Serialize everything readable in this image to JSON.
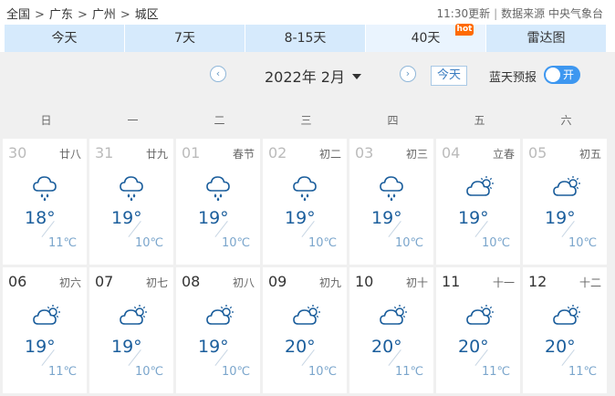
{
  "breadcrumb": [
    {
      "label": "全国",
      "slug": "nation"
    },
    {
      "label": "广东",
      "slug": "guangdong"
    },
    {
      "label": "广州",
      "slug": "guangzhou"
    },
    {
      "label": "城区",
      "slug": "district"
    }
  ],
  "breadcrumb_sep": ">",
  "meta": {
    "update": "11:30更新",
    "source": "数据来源 中央气象台"
  },
  "tabs": [
    {
      "label": "今天",
      "slug": "today",
      "active": false
    },
    {
      "label": "7天",
      "slug": "7day",
      "active": false
    },
    {
      "label": "8-15天",
      "slug": "8-15day",
      "active": false
    },
    {
      "label": "40天",
      "slug": "40day",
      "active": true,
      "badge": "hot"
    },
    {
      "label": "雷达图",
      "slug": "radar",
      "active": false
    }
  ],
  "month_nav": {
    "prev_glyph": "‹",
    "next_glyph": "›",
    "month": "2022年 2月",
    "today_label": "今天"
  },
  "bluesky": {
    "label": "蓝天预报",
    "toggle_label": "开",
    "on": true
  },
  "weekdays": [
    "日",
    "一",
    "二",
    "三",
    "四",
    "五",
    "六"
  ],
  "colors": {
    "tab_bg": "#d6eafc",
    "hi_temp": "#1b5e9c",
    "lo_temp": "#7ba6cc",
    "toggle": "#3d97f0",
    "hot_badge": "#ff6a00"
  },
  "days": [
    {
      "day": "30",
      "lunar": "廿八",
      "icon": "rain-icon",
      "hi": "18°",
      "lo": "11℃",
      "other_month": true
    },
    {
      "day": "31",
      "lunar": "廿九",
      "icon": "rain-icon",
      "hi": "19°",
      "lo": "10℃",
      "other_month": true
    },
    {
      "day": "01",
      "lunar": "春节",
      "icon": "rain-icon",
      "hi": "19°",
      "lo": "10℃",
      "other_month": true
    },
    {
      "day": "02",
      "lunar": "初二",
      "icon": "rain-icon",
      "hi": "19°",
      "lo": "10℃",
      "other_month": true
    },
    {
      "day": "03",
      "lunar": "初三",
      "icon": "rain-icon",
      "hi": "19°",
      "lo": "10℃",
      "other_month": true
    },
    {
      "day": "04",
      "lunar": "立春",
      "icon": "partly-cloudy-icon",
      "hi": "19°",
      "lo": "10℃",
      "other_month": true
    },
    {
      "day": "05",
      "lunar": "初五",
      "icon": "partly-cloudy-icon",
      "hi": "19°",
      "lo": "10℃",
      "other_month": true
    },
    {
      "day": "06",
      "lunar": "初六",
      "icon": "partly-cloudy-icon",
      "hi": "19°",
      "lo": "11℃",
      "other_month": false
    },
    {
      "day": "07",
      "lunar": "初七",
      "icon": "partly-cloudy-icon",
      "hi": "19°",
      "lo": "10℃",
      "other_month": false
    },
    {
      "day": "08",
      "lunar": "初八",
      "icon": "partly-cloudy-icon",
      "hi": "19°",
      "lo": "10℃",
      "other_month": false
    },
    {
      "day": "09",
      "lunar": "初九",
      "icon": "partly-cloudy-icon",
      "hi": "20°",
      "lo": "10℃",
      "other_month": false
    },
    {
      "day": "10",
      "lunar": "初十",
      "icon": "partly-cloudy-icon",
      "hi": "20°",
      "lo": "11℃",
      "other_month": false
    },
    {
      "day": "11",
      "lunar": "十一",
      "icon": "partly-cloudy-icon",
      "hi": "20°",
      "lo": "11℃",
      "other_month": false
    },
    {
      "day": "12",
      "lunar": "十二",
      "icon": "partly-cloudy-icon",
      "hi": "20°",
      "lo": "11℃",
      "other_month": false
    }
  ]
}
